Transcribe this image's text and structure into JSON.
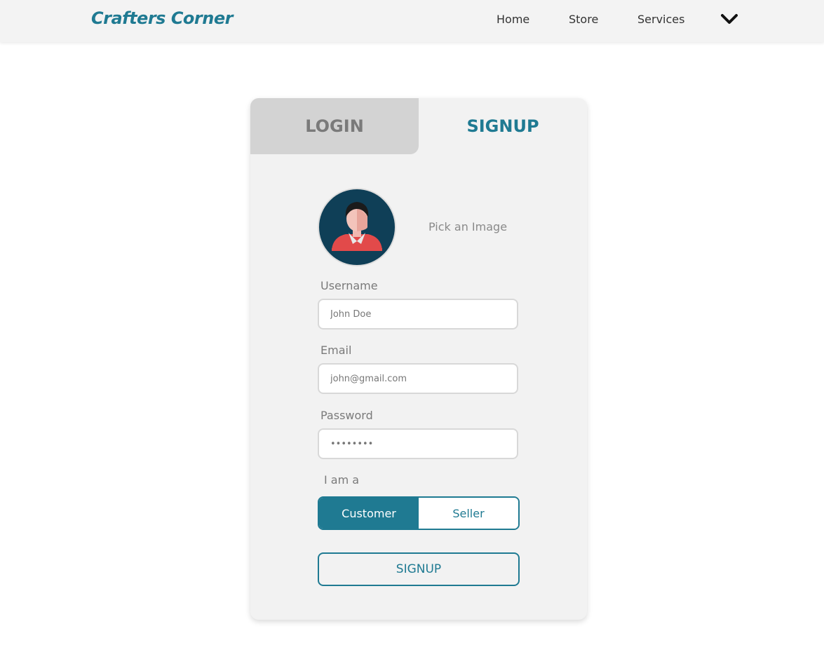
{
  "navbar": {
    "brand": "Crafters Corner",
    "links": [
      "Home",
      "Store",
      "Services"
    ],
    "menu_icon": "chevron-down-icon"
  },
  "auth": {
    "tabs": {
      "login": "LOGIN",
      "signup": "SIGNUP"
    },
    "active_tab": "SIGNUP",
    "avatar_icon": "user-avatar-icon",
    "pick_image": "Pick an Image",
    "username": {
      "label": "Username",
      "placeholder": "John Doe"
    },
    "email": {
      "label": "Email",
      "placeholder": "john@gmail.com"
    },
    "password": {
      "label": "Password",
      "placeholder": "••••••••"
    },
    "role": {
      "label": "I am a",
      "options": [
        "Customer",
        "Seller"
      ],
      "selected": "Customer"
    },
    "submit_label": "SIGNUP"
  },
  "colors": {
    "accent": "#1f7a92",
    "avatar_bg": "#0f3f57",
    "shirt": "#e24a4a"
  }
}
